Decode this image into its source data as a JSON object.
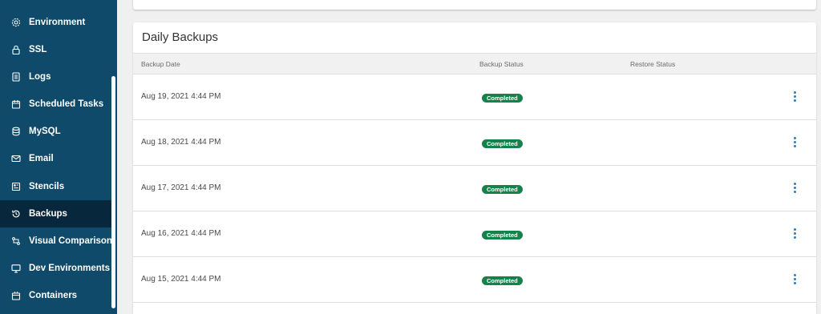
{
  "sidebar": {
    "items": [
      {
        "label": "Environment",
        "icon": "gear-icon"
      },
      {
        "label": "SSL",
        "icon": "lock-icon"
      },
      {
        "label": "Logs",
        "icon": "document-icon"
      },
      {
        "label": "Scheduled Tasks",
        "icon": "calendar-icon"
      },
      {
        "label": "MySQL",
        "icon": "database-icon"
      },
      {
        "label": "Email",
        "icon": "envelope-icon"
      },
      {
        "label": "Stencils",
        "icon": "stencil-icon"
      },
      {
        "label": "Backups",
        "icon": "history-icon",
        "active": true
      },
      {
        "label": "Visual Comparison",
        "icon": "compare-icon"
      },
      {
        "label": "Dev Environments",
        "icon": "monitor-icon"
      },
      {
        "label": "Containers",
        "icon": "container-icon"
      }
    ]
  },
  "daily_backups": {
    "title": "Daily Backups",
    "columns": [
      "Backup Date",
      "Backup Status",
      "Restore Status"
    ],
    "rows": [
      {
        "date": "Aug 19, 2021 4:44 PM",
        "status": "Completed"
      },
      {
        "date": "Aug 18, 2021 4:44 PM",
        "status": "Completed"
      },
      {
        "date": "Aug 17, 2021 4:44 PM",
        "status": "Completed"
      },
      {
        "date": "Aug 16, 2021 4:44 PM",
        "status": "Completed"
      },
      {
        "date": "Aug 15, 2021 4:44 PM",
        "status": "Completed"
      }
    ]
  },
  "colors": {
    "sidebar": "#0f4a6a",
    "sidebar_active": "#07283c",
    "badge_completed": "#14824a",
    "kebab": "#2f7fbf"
  }
}
